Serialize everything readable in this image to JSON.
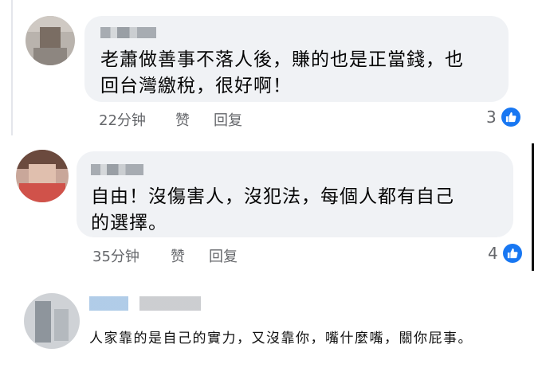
{
  "comments": [
    {
      "text_lines": [
        "老蕭做善事不落人後，賺的也是正當錢，也",
        "回台灣繳稅，很好啊！"
      ],
      "time": "22分钟",
      "like_label": "赞",
      "reply_label": "回复",
      "reaction_count": "3"
    },
    {
      "text_lines": [
        "自由！沒傷害人，沒犯法，每個人都有自己",
        "的選擇。"
      ],
      "time": "35分钟",
      "like_label": "赞",
      "reply_label": "回复",
      "reaction_count": "4"
    },
    {
      "text_lines": [
        "人家靠的是自己的實力，又沒靠你，嘴什麼嘴，關你屁事。"
      ]
    }
  ],
  "colors": {
    "bubble": "#f0f2f5",
    "meta_text": "#65676b",
    "like_blue": "#1877f2"
  },
  "icons": [
    "thumbs-up-icon"
  ]
}
